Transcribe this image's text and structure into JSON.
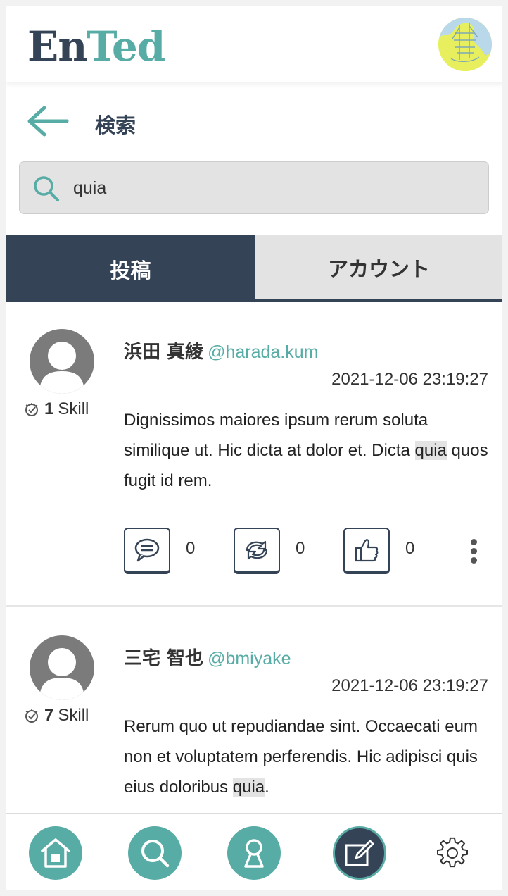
{
  "header": {
    "logo_part1": "En",
    "logo_part2": "Ted",
    "logo_color_dark": "#344356",
    "logo_color_accent": "#57aca5"
  },
  "page": {
    "back_icon": "arrow-left-icon",
    "title": "検索"
  },
  "search": {
    "icon": "search-icon",
    "value": "quia"
  },
  "tabs": [
    {
      "label": "投稿",
      "active": true
    },
    {
      "label": "アカウント",
      "active": false
    }
  ],
  "posts": [
    {
      "name": "浜田 真綾",
      "handle": "@harada.kum",
      "date": "2021-12-06 23:19:27",
      "skill_count": "1",
      "skill_label": "Skill",
      "body_before": "Dignissimos maiores ipsum rerum soluta similique ut. Hic dicta at dolor et. Dicta ",
      "body_highlight": "quia",
      "body_after": " quos fugit id rem.",
      "comments": "0",
      "reposts": "0",
      "likes": "0"
    },
    {
      "name": "三宅 智也",
      "handle": "@bmiyake",
      "date": "2021-12-06 23:19:27",
      "skill_count": "7",
      "skill_label": "Skill",
      "body_before": "Rerum quo ut repudiandae sint. Occaecati eum non et voluptatem perferendis. Hic adipisci quis eius doloribus ",
      "body_highlight": "quia",
      "body_after": "."
    }
  ],
  "bottom_nav": [
    "home-icon",
    "search-icon",
    "profile-icon",
    "compose-icon",
    "gear-icon"
  ],
  "colors": {
    "primary": "#344356",
    "accent": "#57aca5",
    "highlight": "#e3e3e3"
  }
}
